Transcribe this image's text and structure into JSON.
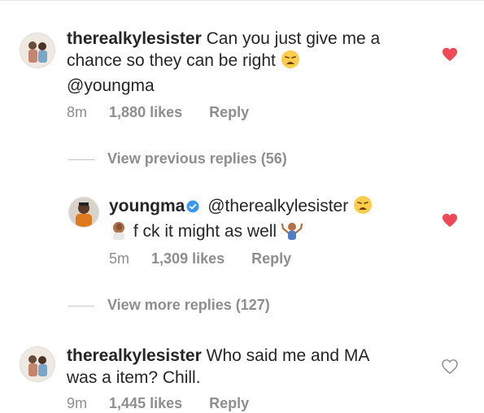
{
  "comments": [
    {
      "username": "therealkylesister",
      "text_line1": "Can you just give me a",
      "text_line2": "chance so they can be right",
      "text_line3": "@youngma",
      "time": "8m",
      "likes": "1,880 likes",
      "reply": "Reply",
      "liked": true
    },
    {
      "username": "therealkylesister",
      "text_line1": "Who said me and MA",
      "text_line2": "was a item? Chill.",
      "time": "9m",
      "likes": "1,445 likes",
      "reply": "Reply",
      "liked": false
    }
  ],
  "view_previous": "View previous replies (56)",
  "reply_comment": {
    "username": "youngma",
    "mention": "@therealkylesister",
    "text_part1": "f",
    "text_part2": "ck it might as well",
    "time": "5m",
    "likes": "1,309 likes",
    "reply": "Reply",
    "liked": true
  },
  "view_more": "View more replies (127)",
  "colors": {
    "heart_red": "#ed4956",
    "muted": "#8e8e8e",
    "verified_blue": "#3897f0"
  },
  "icons": {
    "liked": "heart-filled-icon",
    "unliked": "heart-outline-icon",
    "verified": "verified-badge-icon",
    "weary": "weary-face-emoji",
    "facepalm": "man-facepalming-emoji",
    "shrug": "man-shrugging-emoji"
  }
}
